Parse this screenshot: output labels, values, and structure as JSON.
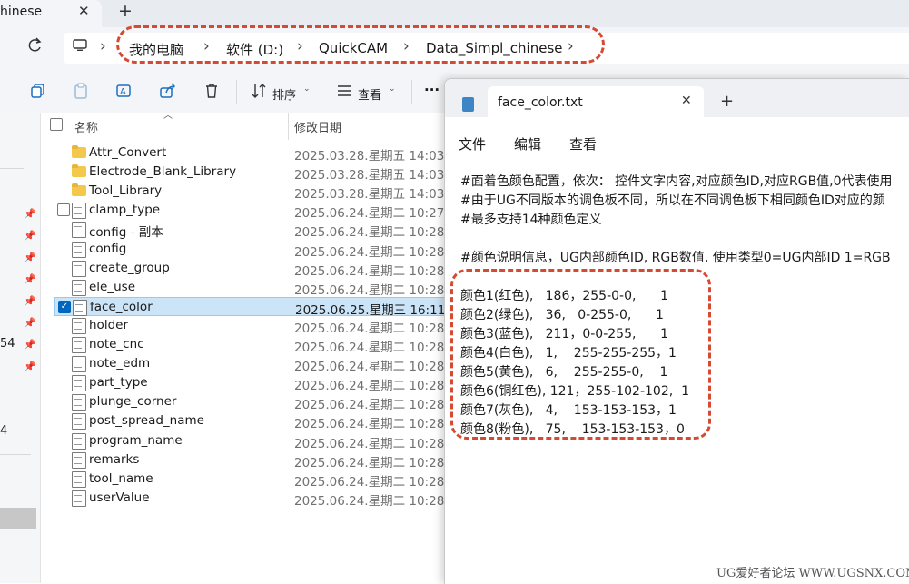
{
  "explorer": {
    "tab": {
      "title": "hinese",
      "close": "✕",
      "new": "+"
    },
    "breadcrumb": [
      "我的电脑",
      "软件 (D:)",
      "QuickCAM",
      "Data_Simpl_chinese"
    ],
    "toolbar": {
      "sort_label": "排序",
      "view_label": "查看",
      "more": "···"
    },
    "columns": {
      "name": "名称",
      "date": "修改日期"
    },
    "nav_fragments": [
      "54",
      "4"
    ],
    "files": [
      {
        "name": "Attr_Convert",
        "date": "2025.03.28.星期五 14:03",
        "type": "folder"
      },
      {
        "name": "Electrode_Blank_Library",
        "date": "2025.03.28.星期五 14:03",
        "type": "folder"
      },
      {
        "name": "Tool_Library",
        "date": "2025.03.28.星期五 14:03",
        "type": "folder"
      },
      {
        "name": "clamp_type",
        "date": "2025.06.24.星期二 10:27",
        "type": "txt"
      },
      {
        "name": "config - 副本",
        "date": "2025.06.24.星期二 10:28",
        "type": "cfg"
      },
      {
        "name": "config",
        "date": "2025.06.24.星期二 10:28",
        "type": "cfg"
      },
      {
        "name": "create_group",
        "date": "2025.06.24.星期二 10:28",
        "type": "txt"
      },
      {
        "name": "ele_use",
        "date": "2025.06.24.星期二 10:28",
        "type": "txt"
      },
      {
        "name": "face_color",
        "date": "2025.06.25.星期三 16:11",
        "type": "txt",
        "selected": true
      },
      {
        "name": "holder",
        "date": "2025.06.24.星期二 10:28",
        "type": "txt"
      },
      {
        "name": "note_cnc",
        "date": "2025.06.24.星期二 10:28",
        "type": "txt"
      },
      {
        "name": "note_edm",
        "date": "2025.06.24.星期二 10:28",
        "type": "txt"
      },
      {
        "name": "part_type",
        "date": "2025.06.24.星期二 10:28",
        "type": "txt"
      },
      {
        "name": "plunge_corner",
        "date": "2025.06.24.星期二 10:28",
        "type": "txt"
      },
      {
        "name": "post_spread_name",
        "date": "2025.06.24.星期二 10:28",
        "type": "txt"
      },
      {
        "name": "program_name",
        "date": "2025.06.24.星期二 10:28",
        "type": "txt"
      },
      {
        "name": "remarks",
        "date": "2025.06.24.星期二 10:28",
        "type": "txt"
      },
      {
        "name": "tool_name",
        "date": "2025.06.24.星期二 10:28",
        "type": "txt"
      },
      {
        "name": "userValue",
        "date": "2025.06.24.星期二 10:28",
        "type": "txt"
      }
    ]
  },
  "notepad": {
    "tab_title": "face_color.txt",
    "tab_close": "✕",
    "tab_new": "+",
    "menu": [
      "文件",
      "编辑",
      "查看"
    ],
    "lines": [
      "#面着色颜色配置，依次： 控件文字内容,对应颜色ID,对应RGB值,0代表使用",
      "#由于UG不同版本的调色板不同，所以在不同调色板下相同颜色ID对应的颜",
      "#最多支持14种颜色定义",
      "",
      "#颜色说明信息，UG内部颜色ID, RGB数值, 使用类型0=UG内部ID 1=RGB",
      "",
      "颜色1(红色),   186，255-0-0,      1",
      "颜色2(绿色),   36,   0-255-0,      1",
      "颜色3(蓝色),   211，0-0-255,      1",
      "颜色4(白色),   1,    255-255-255，1",
      "颜色5(黄色),   6,    255-255-0,    1",
      "颜色6(铜红色), 121，255-102-102,  1",
      "颜色7(灰色),   4,    153-153-153，1",
      "颜色8(粉色),   75,    153-153-153，0"
    ]
  },
  "watermark": "UG爱好者论坛 WWW.UGSNX.COM",
  "colors": {
    "highlight": "#d64a32",
    "selection": "#cce4f7",
    "accent": "#0067c0"
  }
}
